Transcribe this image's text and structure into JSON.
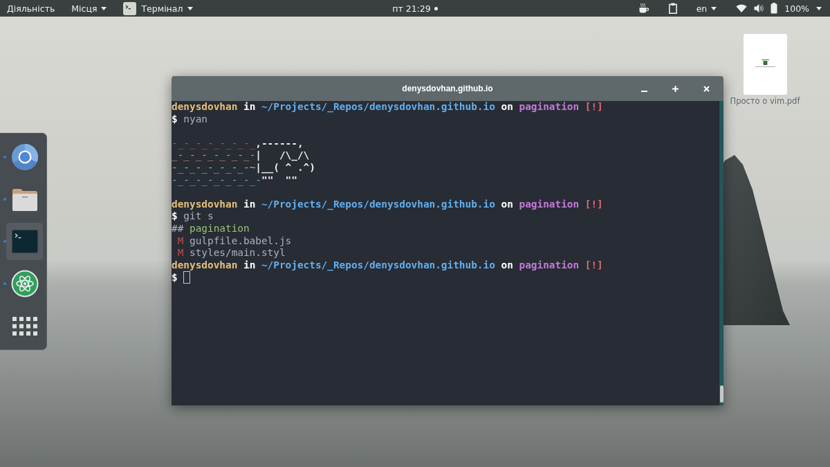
{
  "top_bar": {
    "activities": "Діяльність",
    "places_menu": "Місця",
    "app_menu": "Термінал",
    "clock": "пт 21:29",
    "clock_notification": true,
    "input_source": "en",
    "battery": "100%"
  },
  "dock": {
    "items": [
      {
        "kind": "aperture",
        "running": true,
        "selected": false
      },
      {
        "kind": "folder",
        "running": true,
        "selected": false
      },
      {
        "kind": "terminal",
        "running": true,
        "selected": true
      },
      {
        "kind": "atom",
        "running": true,
        "selected": false
      },
      {
        "kind": "app_grid",
        "running": false,
        "selected": false
      }
    ]
  },
  "terminal": {
    "title": "denysdovhan.github.io",
    "lines": [
      {
        "kind": "prompt",
        "segments": [
          {
            "kind": "user",
            "text": "denysdovhan"
          },
          {
            "kind": "keyword",
            "text": "in"
          },
          {
            "kind": "path",
            "text": "~/Projects/_Repos/denysdovhan.github.io"
          },
          {
            "kind": "keyword",
            "text": "on"
          },
          {
            "kind": "branch",
            "text": "pagination"
          },
          {
            "kind": "status",
            "text": "[!]"
          }
        ]
      },
      {
        "kind": "command",
        "segments": [
          {
            "kind": "sigil",
            "text": "$"
          },
          {
            "kind": "plain",
            "text": "nyan"
          }
        ]
      },
      {
        "kind": "blank"
      },
      {
        "kind": "art",
        "segments": [
          {
            "kind": "rainbow",
            "color": "#c0544c",
            "text": "-_-_-_-_-_-_-_"
          },
          {
            "kind": "cat",
            "text": ",------,"
          }
        ]
      },
      {
        "kind": "art",
        "segments": [
          {
            "kind": "rainbow",
            "color": "#d19a66",
            "text": "_-_-_-_-_-_-_-"
          },
          {
            "kind": "cat",
            "text": "|   /\\_/\\"
          }
        ]
      },
      {
        "kind": "art",
        "segments": [
          {
            "kind": "rainbow",
            "color": "#98c379",
            "text": "-_-_-_-_-_-_-~"
          },
          {
            "kind": "cat",
            "text": "|__( ^ .^)"
          }
        ]
      },
      {
        "kind": "art",
        "segments": [
          {
            "kind": "rainbow",
            "color": "#56b6c2",
            "text": "-_-_-_-_-_-_-_-"
          },
          {
            "kind": "cat",
            "text": "\"\"  \"\""
          }
        ]
      },
      {
        "kind": "blank"
      },
      {
        "kind": "prompt",
        "segments": [
          {
            "kind": "user",
            "text": "denysdovhan"
          },
          {
            "kind": "keyword",
            "text": "in"
          },
          {
            "kind": "path",
            "text": "~/Projects/_Repos/denysdovhan.github.io"
          },
          {
            "kind": "keyword",
            "text": "on"
          },
          {
            "kind": "branch",
            "text": "pagination"
          },
          {
            "kind": "status",
            "text": "[!]"
          }
        ]
      },
      {
        "kind": "command",
        "segments": [
          {
            "kind": "sigil",
            "text": "$"
          },
          {
            "kind": "plain",
            "text": "git s"
          }
        ]
      },
      {
        "kind": "output",
        "segments": [
          {
            "kind": "plain",
            "text": "##"
          },
          {
            "kind": "git_branch",
            "text": "pagination"
          }
        ]
      },
      {
        "kind": "file",
        "segments": [
          {
            "kind": "modified",
            "text": "M"
          },
          {
            "kind": "plain",
            "text": "gulpfile.babel.js"
          }
        ]
      },
      {
        "kind": "file",
        "segments": [
          {
            "kind": "modified",
            "text": "M"
          },
          {
            "kind": "plain",
            "text": "styles/main.styl"
          }
        ]
      },
      {
        "kind": "prompt",
        "segments": [
          {
            "kind": "user",
            "text": "denysdovhan"
          },
          {
            "kind": "keyword",
            "text": "in"
          },
          {
            "kind": "path",
            "text": "~/Projects/_Repos/denysdovhan.github.io"
          },
          {
            "kind": "keyword",
            "text": "on"
          },
          {
            "kind": "branch",
            "text": "pagination"
          },
          {
            "kind": "status",
            "text": "[!]"
          }
        ]
      },
      {
        "kind": "input",
        "cursor": true,
        "segments": [
          {
            "kind": "sigil",
            "text": "$"
          }
        ]
      }
    ]
  },
  "desktop_icons": [
    {
      "label": "Просто о vim.pdf"
    }
  ]
}
